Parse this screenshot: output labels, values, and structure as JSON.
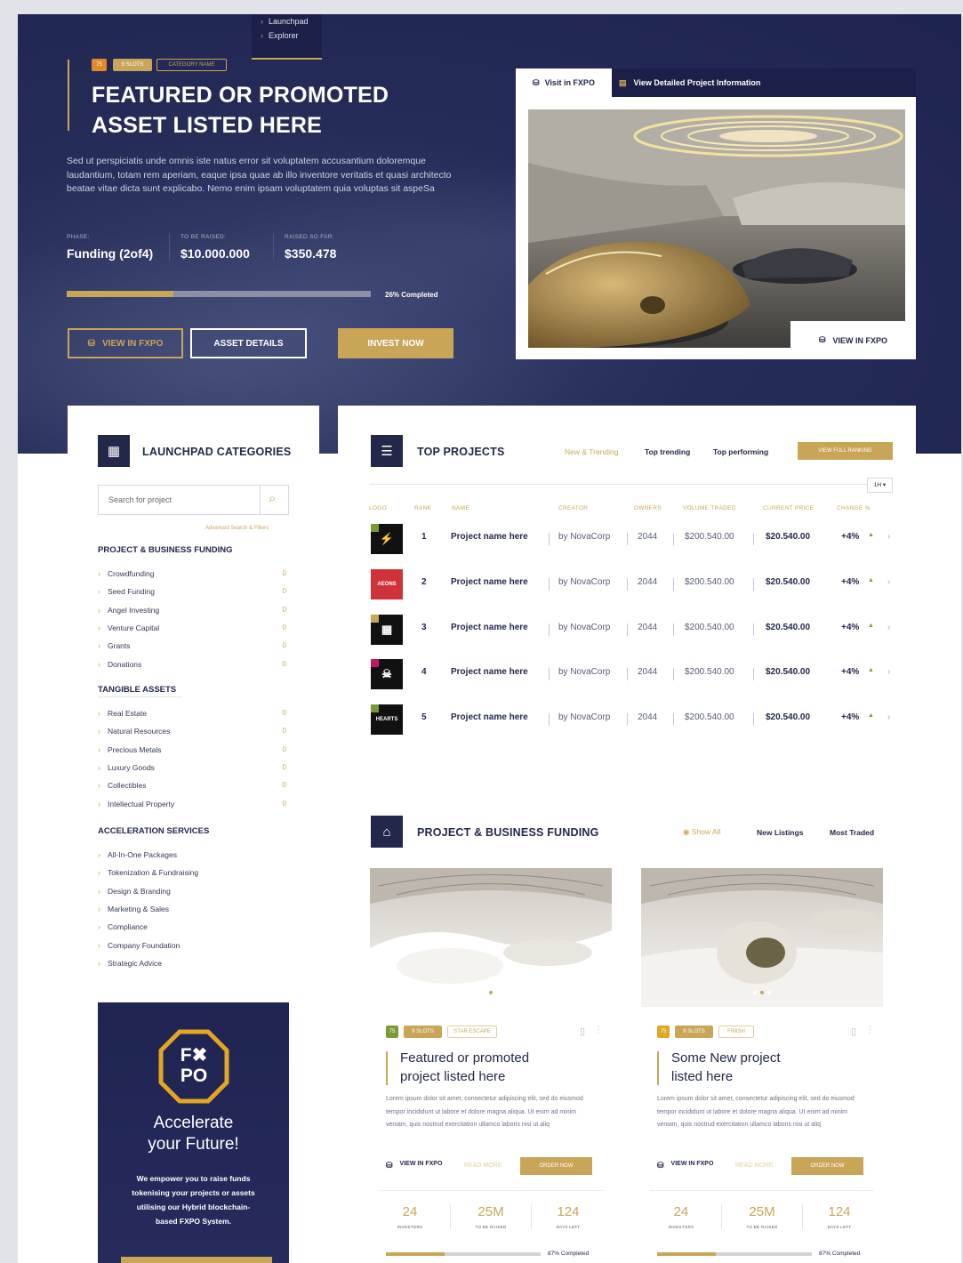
{
  "colors": {
    "navy": "#23284a",
    "hero": "#262c58",
    "gold": "#c9a558",
    "green_badge": "#7a9a3a"
  },
  "nav": {
    "items": [
      "Launchpad",
      "Explorer"
    ]
  },
  "hero": {
    "badges": {
      "b1": "75",
      "b2": "9 SLOTS",
      "b3": "CATEGORY NAME"
    },
    "title_line1": "FEATURED OR PROMOTED",
    "title_line2": "ASSET LISTED HERE",
    "description": "Sed ut perspiciatis unde omnis iste natus error sit voluptatem accusantium doloremque laudantium, totam rem aperiam, eaque ipsa quae ab illo inventore veritatis et quasi architecto beatae vitae dicta sunt explicabo. Nemo enim ipsam voluptatem quia voluptas sit aspeSa",
    "stats": [
      {
        "label": "PHASE:",
        "value": "Funding (2of4)"
      },
      {
        "label": "TO BE RAISED:",
        "value": "$10.000.000"
      },
      {
        "label": "RAISED SO FAR:",
        "value": "$350.478"
      }
    ],
    "progress": {
      "fraction": 0.35,
      "label": "26% Completed"
    },
    "buttons": {
      "view_fxpo": "VIEW IN FXPO",
      "asset_details": "ASSET DETAILS",
      "invest_now": "INVEST NOW"
    },
    "media_tabs": {
      "visit": "Visit in FXPO",
      "detailed": "View Detailed Project Information"
    },
    "media_overlay": "VIEW IN FXPO"
  },
  "categories": {
    "title": "LAUNCHPAD CATEGORIES",
    "search_placeholder": "Search for project",
    "advanced": "Advanced Search & Filters",
    "groups": [
      {
        "heading": "PROJECT & BUSINESS FUNDING",
        "items": [
          "Crowdfunding",
          "Seed Funding",
          "Angel Investing",
          "Venture Capital",
          "Grants",
          "Donations"
        ],
        "counts": [
          "0",
          "0",
          "0",
          "0",
          "0",
          "0"
        ]
      },
      {
        "heading": "TANGIBLE ASSETS",
        "items": [
          "Real Estate",
          "Natural Resources",
          "Precious Metals",
          "Luxury Goods",
          "Collectibles",
          "Intellectual Property"
        ],
        "counts": [
          "0",
          "0",
          "0",
          "0",
          "0",
          "0"
        ]
      },
      {
        "heading": "ACCELERATION SERVICES",
        "items": [
          "All-In-One Packages",
          "Tokenization & Fundraising",
          "Design & Branding",
          "Marketing & Sales",
          "Compliance",
          "Company Foundation",
          "Strategic Advice"
        ]
      }
    ]
  },
  "promo": {
    "logo_top": "F✖",
    "logo_bottom": "PO",
    "title_line1": "Accelerate",
    "title_line2": "your Future!",
    "text_lines": [
      "We empower you to raise funds",
      "tokenising your projects or assets",
      "utilising our Hybrid blockchain-",
      "based FXPO System."
    ]
  },
  "top_projects": {
    "title": "TOP PROJECTS",
    "tabs": [
      "New & Trending",
      "Top trending",
      "Top performing"
    ],
    "view_all": "VIEW FULL RANKING",
    "pager": "1H ▾",
    "headers": [
      "LOGO",
      "RANK",
      "NAME",
      "CREATOR",
      "OWNERS",
      "VOLUME TRADED",
      "CURRENT PRICE",
      "CHANGE %"
    ],
    "rows": [
      {
        "rank": "1",
        "name": "Project name here",
        "creator": "by NovaCorp",
        "owners": "2044",
        "volume": "$200.540.00",
        "price": "$20.540.00",
        "change": "+4%",
        "logo_text": "⚡"
      },
      {
        "rank": "2",
        "name": "Project name here",
        "creator": "by NovaCorp",
        "owners": "2044",
        "volume": "$200.540.00",
        "price": "$20.540.00",
        "change": "+4%",
        "logo_text": "AEONS"
      },
      {
        "rank": "3",
        "name": "Project name here",
        "creator": "by NovaCorp",
        "owners": "2044",
        "volume": "$200.540.00",
        "price": "$20.540.00",
        "change": "+4%",
        "logo_text": "▦"
      },
      {
        "rank": "4",
        "name": "Project name here",
        "creator": "by NovaCorp",
        "owners": "2044",
        "volume": "$200.540.00",
        "price": "$20.540.00",
        "change": "+4%",
        "logo_text": "☠"
      },
      {
        "rank": "5",
        "name": "Project name here",
        "creator": "by NovaCorp",
        "owners": "2044",
        "volume": "$200.540.00",
        "price": "$20.540.00",
        "change": "+4%",
        "logo_text": "HEARTS"
      }
    ]
  },
  "funding": {
    "title": "PROJECT & BUSINESS FUNDING",
    "tabs": [
      "Show All",
      "New Listings",
      "Most Traded"
    ],
    "cards": [
      {
        "badge1": "75",
        "badge2": "9 SLOTS",
        "badge3": "STAR ESCAPE",
        "title_line1": "Featured or promoted",
        "title_line2": "project listed here",
        "desc": "Lorem ipsum dolor sit amet, consectetur adipiscing elit, sed do eiusmod tempor incididunt ut labore et dolore magna aliqua. Ut enim ad minim veniam, quis nostrud exercitation ullamco laboris nisi ut aliq",
        "view": "VIEW IN FXPO",
        "read": "READ MORE",
        "order": "ORDER NOW",
        "stats": [
          {
            "n": "24",
            "l": "INVESTORS"
          },
          {
            "n": "25M",
            "l": "TO BE RAISED"
          },
          {
            "n": "124",
            "l": "DAYS LEFT"
          }
        ],
        "progress": 0.38,
        "progress_label": "87% Completed"
      },
      {
        "badge1": "75",
        "badge2": "9 SLOTS",
        "badge3": "FINISH",
        "title_line1": "Some New project",
        "title_line2": "listed here",
        "desc": "Lorem ipsum dolor sit amet, consectetur adipiscing elit, sed do eiusmod tempor incididunt ut labore et dolore magna aliqua. Ut enim ad minim veniam, quis nostrud exercitation ullamco laboris nisi ut aliq",
        "view": "VIEW IN FXPO",
        "read": "READ MORE",
        "order": "ORDER NOW",
        "stats": [
          {
            "n": "24",
            "l": "INVESTORS"
          },
          {
            "n": "25M",
            "l": "TO BE RAISED"
          },
          {
            "n": "124",
            "l": "DAYS LEFT"
          }
        ],
        "progress": 0.38,
        "progress_label": "87% Completed"
      }
    ]
  }
}
